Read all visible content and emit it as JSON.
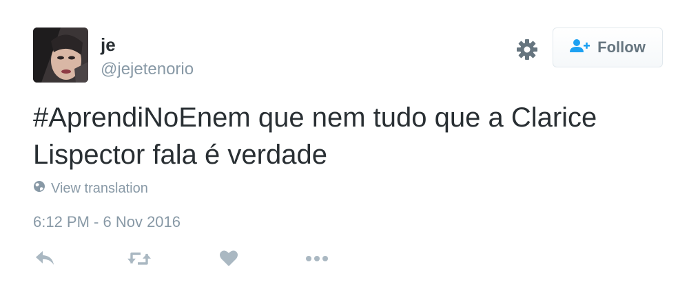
{
  "user": {
    "name": "je",
    "handle": "@jejetenorio"
  },
  "header": {
    "settings_icon": "gear-icon",
    "follow_label": "Follow",
    "follow_icon": "add-user-icon"
  },
  "tweet": {
    "hashtag": "#AprendiNoEnem",
    "body": " que nem tudo que a Clarice Lispector fala é verdade",
    "translate_label": "View translation",
    "translate_icon": "globe-icon",
    "timestamp": "6:12 PM - 6 Nov 2016"
  },
  "actions": [
    {
      "icon": "reply-icon"
    },
    {
      "icon": "retweet-icon"
    },
    {
      "icon": "like-icon"
    },
    {
      "icon": "more-icon"
    }
  ],
  "colors": {
    "text": "#292f33",
    "muted": "#8899a6",
    "accent": "#1da1f2",
    "action_icons": "#aab8c2"
  }
}
